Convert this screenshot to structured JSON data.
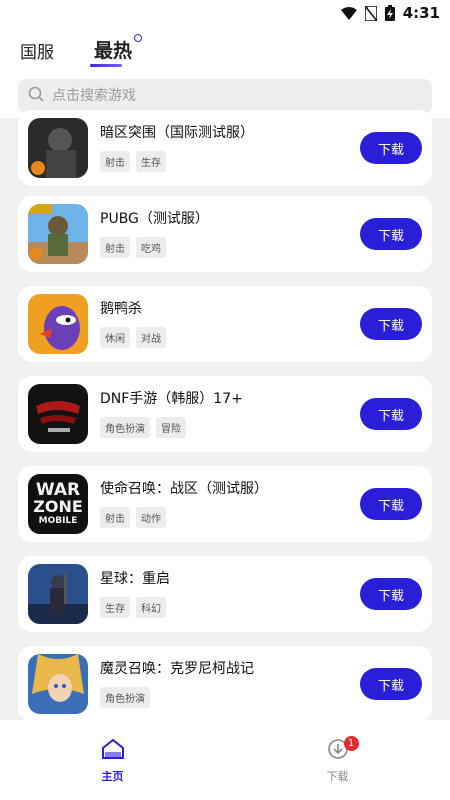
{
  "status_bar": {
    "time": "4:31"
  },
  "tabs": [
    {
      "label": "国服",
      "active": false
    },
    {
      "label": "最热",
      "active": true
    }
  ],
  "search": {
    "placeholder": "点击搜索游戏"
  },
  "games": [
    {
      "name": "暗区突围（国际测试服）",
      "tags": [
        "射击",
        "生存"
      ],
      "button": "下载"
    },
    {
      "name": "PUBG（测试服）",
      "tags": [
        "射击",
        "吃鸡"
      ],
      "button": "下载"
    },
    {
      "name": "鹅鸭杀",
      "tags": [
        "休闲",
        "对战"
      ],
      "button": "下载"
    },
    {
      "name": "DNF手游（韩服）17+",
      "tags": [
        "角色扮演",
        "冒险"
      ],
      "button": "下载"
    },
    {
      "name": "使命召唤：战区（测试服）",
      "tags": [
        "射击",
        "动作"
      ],
      "button": "下载"
    },
    {
      "name": "星球：重启",
      "tags": [
        "生存",
        "科幻"
      ],
      "button": "下载"
    },
    {
      "name": "魔灵召唤：克罗尼柯战记",
      "tags": [
        "角色扮演"
      ],
      "button": "下载"
    }
  ],
  "thumb_labels": {
    "warzone": [
      "WAR",
      "ZONE",
      "MOBILE"
    ]
  },
  "bottom_nav": [
    {
      "label": "主页",
      "active": true
    },
    {
      "label": "下载",
      "active": false,
      "badge": "1"
    }
  ],
  "colors": {
    "accent": "#2a1fd9",
    "badge": "#e42c2c",
    "list_bg": "#f1f1f1"
  }
}
